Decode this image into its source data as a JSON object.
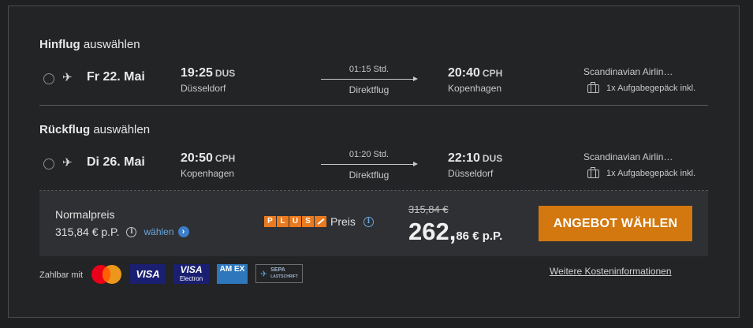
{
  "outbound": {
    "heading_bold": "Hinflug",
    "heading_rest": " auswählen",
    "date": "Fr 22. Mai",
    "dep_time": "19:25",
    "dep_code": "DUS",
    "dep_city": "Düsseldorf",
    "duration": "01:15 Std.",
    "stops": "Direktflug",
    "arr_time": "20:40",
    "arr_code": "CPH",
    "arr_city": "Kopenhagen",
    "airline": "Scandinavian Airlin…",
    "baggage": "1x Aufgabegepäck inkl."
  },
  "return": {
    "heading_bold": "Rückflug",
    "heading_rest": " auswählen",
    "date": "Di 26. Mai",
    "dep_time": "20:50",
    "dep_code": "CPH",
    "dep_city": "Kopenhagen",
    "duration": "01:20 Std.",
    "stops": "Direktflug",
    "arr_time": "22:10",
    "arr_code": "DUS",
    "arr_city": "Düsseldorf",
    "airline": "Scandinavian Airlin…",
    "baggage": "1x Aufgabegepäck inkl."
  },
  "pricing": {
    "normal_label": "Normalpreis",
    "normal_price": "315,84 € p.P.",
    "choose_link": "wählen",
    "plus_letters": [
      "P",
      "L",
      "U",
      "S"
    ],
    "plus_label": "Preis",
    "old_price": "315,84 €",
    "price_main": "262,",
    "price_cents": "86",
    "price_suffix": " € p.P.",
    "cta_label": "ANGEBOT WÄHLEN"
  },
  "payment": {
    "label": "Zahlbar mit",
    "visa": "VISA",
    "visa_electron_top": "VISA",
    "visa_electron_bottom": "Electron",
    "amex": "AM EX",
    "sepa": "SEPA",
    "sepa_sub": "LASTSCHRIFT",
    "more_costs": "Weitere Kosteninformationen"
  },
  "colors": {
    "background": "#1f2022",
    "accent_cta": "#d2780f",
    "plus_orange": "#e97a1f",
    "link_blue": "#6aa6df"
  }
}
